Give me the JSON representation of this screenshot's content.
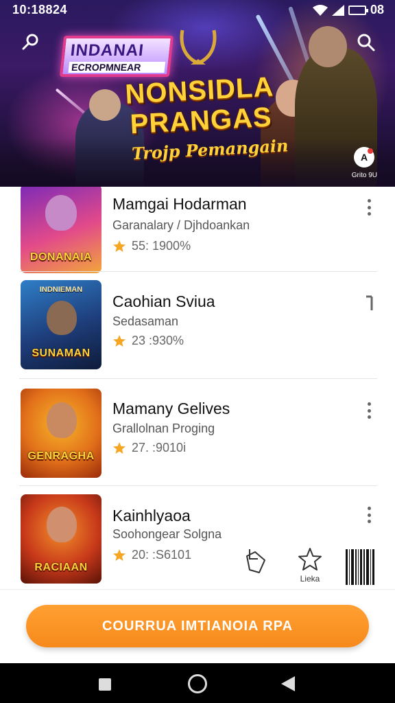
{
  "status_bar": {
    "time": "10:18824",
    "battery": "08"
  },
  "hero": {
    "logo_line1": "INDANAI",
    "logo_line2": "ECROPMNEAR",
    "title_line1": "NONSIDLA",
    "title_line2": "PRANGAS",
    "subtitle": "Trojp Pemangain",
    "badge_icon": "A",
    "caption": "Grito 9U"
  },
  "list": {
    "items": [
      {
        "title": "Mamgai Hodarman",
        "subtitle": "Garanalary / Djhdoankan",
        "rating": "55: 1900%",
        "thumb_top": "",
        "thumb_label": "DONANAIA",
        "thumb_colors": [
          "#7a2ab8",
          "#e24a8a",
          "#f2a63a"
        ]
      },
      {
        "title": "Caohian Sviua",
        "subtitle": "Sedasaman",
        "rating": "23 :930%",
        "thumb_top": "INDNIEMAN",
        "thumb_label": "SUNAMAN",
        "thumb_colors": [
          "#1e3d7a",
          "#2f7fc8",
          "#0e1c3a"
        ]
      },
      {
        "title": "Mamany Gelives",
        "subtitle": "Grallolnan Proging",
        "rating": "27. :9010i",
        "thumb_top": "",
        "thumb_label": "GENRAGHA",
        "thumb_colors": [
          "#e2701a",
          "#f7b52a",
          "#9a2a0a"
        ]
      },
      {
        "title": "Kainhlyaoa",
        "subtitle": "Soohongear Solgna",
        "rating": "20: :S6101",
        "thumb_top": "",
        "thumb_label": "RACIAAN",
        "thumb_colors": [
          "#c8391a",
          "#f2902a",
          "#5a1208"
        ]
      }
    ]
  },
  "actions": {
    "favorite_label": "Lieka"
  },
  "cta": {
    "label": "COURRUA IMTIANOIA RPA"
  },
  "colors": {
    "accent": "#f7891b",
    "star": "#f5a623",
    "hero_title": "#ffd23a"
  },
  "icons": {
    "back": "search-back-icon",
    "search": "search-icon",
    "more": "more-vert-icon",
    "share": "share-icon",
    "favorite": "star-outline-icon",
    "barcode": "barcode-icon"
  }
}
